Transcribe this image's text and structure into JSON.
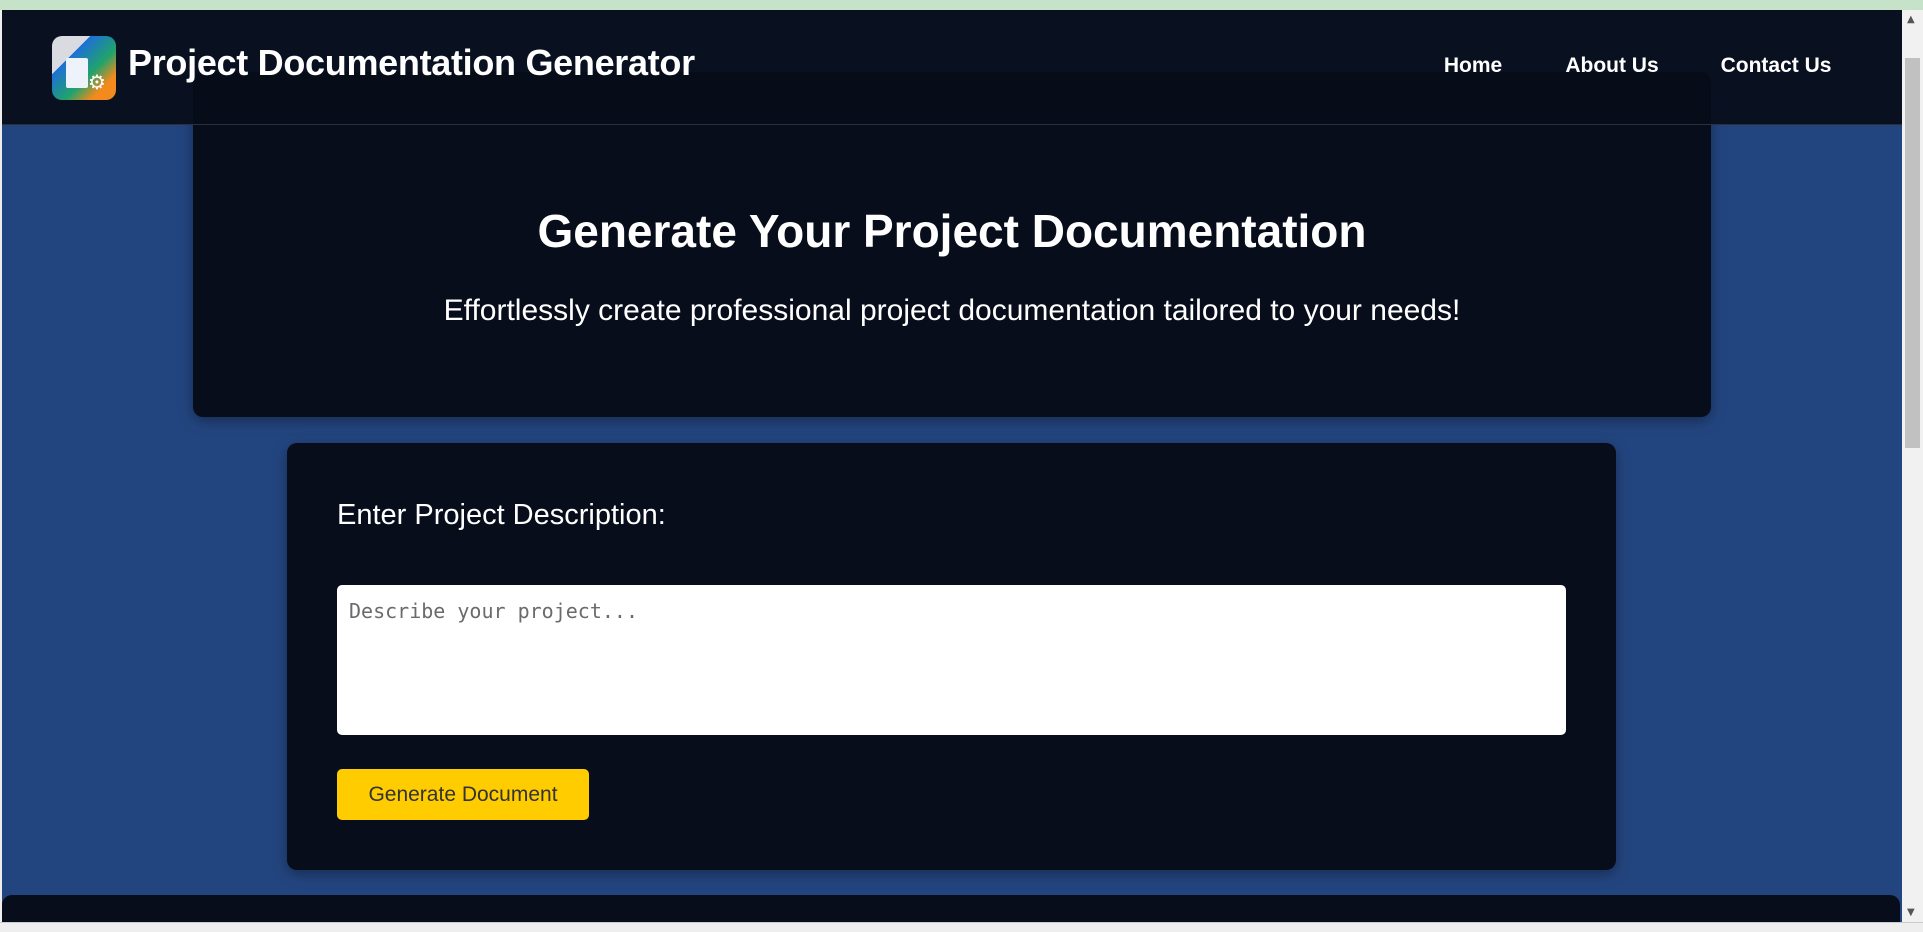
{
  "header": {
    "brand": "Project Documentation Generator",
    "nav": [
      "Home",
      "About Us",
      "Contact Us"
    ]
  },
  "hero": {
    "title": "Generate Your Project Documentation",
    "subtitle": "Effortlessly create professional project documentation tailored to your needs!"
  },
  "form": {
    "label": "Enter Project Description:",
    "placeholder": "Describe your project...",
    "value": "",
    "button": "Generate Document"
  },
  "colors": {
    "background": "#23457f",
    "card": "#070d1a",
    "accent": "#ffcc00"
  }
}
